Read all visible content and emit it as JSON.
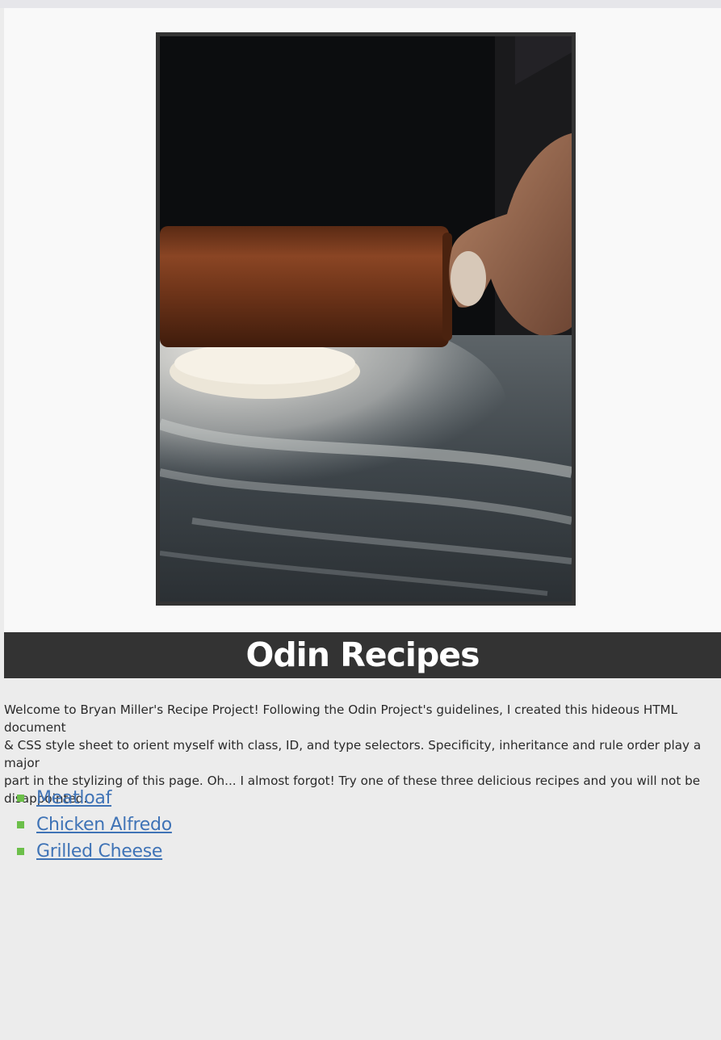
{
  "page": {
    "title": "Odin Recipes",
    "intro": "Welcome to Bryan Miller's Recipe Project! Following the Odin Project's guidelines, I created this hideous HTML document\n& CSS style sheet to orient myself with class, ID, and type selectors. Specificity, inheritance and rule order play a major\npart in the stylizing of this page. Oh... I almost forgot! Try one of these three delicious recipes and you will not be\ndisappointed."
  },
  "hero_image": {
    "subject": "rolling pin on floured dough"
  },
  "recipes": [
    {
      "label": "Meatloaf"
    },
    {
      "label": "Chicken Alfredo"
    },
    {
      "label": "Grilled Cheese"
    }
  ],
  "colors": {
    "background": "#ececec",
    "hero_background": "#f9f9f9",
    "title_bar": "#333333",
    "link": "#3f73b6",
    "bullet": "#6cbf4a"
  }
}
